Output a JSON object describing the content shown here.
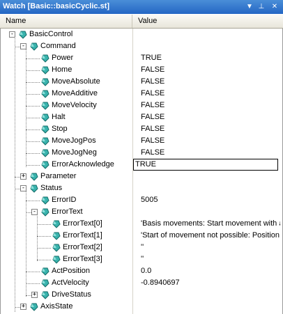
{
  "window": {
    "title": "Watch [Basic::basicCyclic.st]"
  },
  "columns": {
    "name": "Name",
    "value": "Value"
  },
  "rows": [
    {
      "label": "BasicControl",
      "value": "",
      "expander": "-"
    },
    {
      "label": "Command",
      "value": "",
      "expander": "-"
    },
    {
      "label": "Power",
      "value": "TRUE"
    },
    {
      "label": "Home",
      "value": "FALSE"
    },
    {
      "label": "MoveAbsolute",
      "value": "FALSE"
    },
    {
      "label": "MoveAdditive",
      "value": "FALSE"
    },
    {
      "label": "MoveVelocity",
      "value": "FALSE"
    },
    {
      "label": "Halt",
      "value": "FALSE"
    },
    {
      "label": "Stop",
      "value": "FALSE"
    },
    {
      "label": "MoveJogPos",
      "value": "FALSE"
    },
    {
      "label": "MoveJogNeg",
      "value": "FALSE"
    },
    {
      "label": "ErrorAcknowledge",
      "value": "TRUE",
      "editing": true
    },
    {
      "label": "Parameter",
      "value": "",
      "expander": "+"
    },
    {
      "label": "Status",
      "value": "",
      "expander": "-"
    },
    {
      "label": "ErrorID",
      "value": "5005"
    },
    {
      "label": "ErrorText",
      "value": "",
      "expander": "-"
    },
    {
      "label": "ErrorText[0]",
      "value": "'Basis movements: Start movement with a"
    },
    {
      "label": "ErrorText[1]",
      "value": "'Start of movement not possible: Position c"
    },
    {
      "label": "ErrorText[2]",
      "value": "''"
    },
    {
      "label": "ErrorText[3]",
      "value": "''"
    },
    {
      "label": "ActPosition",
      "value": "0.0"
    },
    {
      "label": "ActVelocity",
      "value": "-0.8940697"
    },
    {
      "label": "DriveStatus",
      "value": "",
      "expander": "+"
    },
    {
      "label": "AxisState",
      "value": "",
      "expander": "+"
    }
  ],
  "icons": {
    "variable": "gem-icon",
    "accent": "#2aa6a0"
  },
  "colors": {
    "titlebar": "#2a6fca",
    "header": "#ece9d8"
  }
}
